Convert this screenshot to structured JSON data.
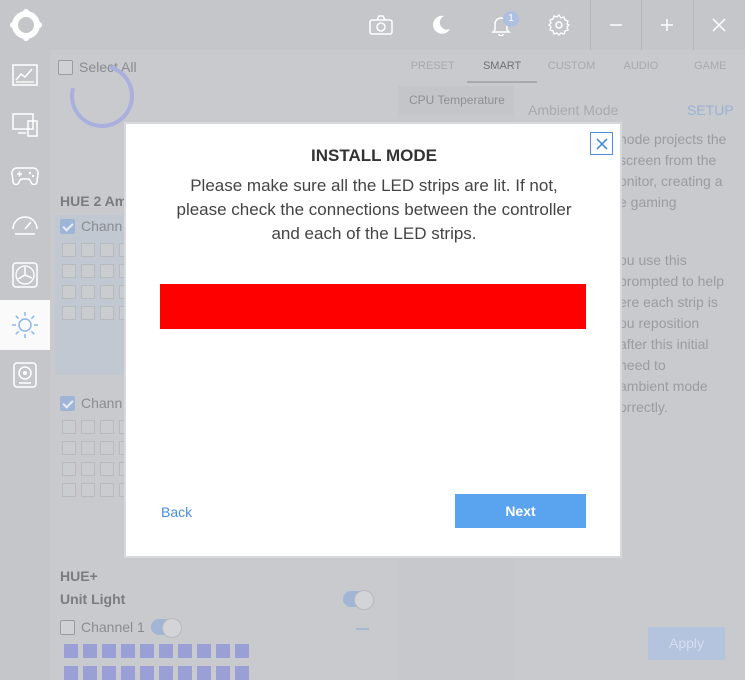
{
  "titlebar": {
    "notification_count": "1",
    "icons": [
      "camera-icon",
      "moon-icon",
      "bell-icon",
      "gear-icon",
      "minimize-icon",
      "maximize-icon",
      "close-icon"
    ]
  },
  "sidebar": {
    "items": [
      {
        "name": "dashboard",
        "icon": "monitor-chart-icon"
      },
      {
        "name": "pc-components",
        "icon": "desktop-icon"
      },
      {
        "name": "games",
        "icon": "gamepad-icon"
      },
      {
        "name": "performance",
        "icon": "gauge-icon"
      },
      {
        "name": "cooling",
        "icon": "fan-icon"
      },
      {
        "name": "lighting",
        "icon": "sun-icon",
        "active": true
      },
      {
        "name": "camera",
        "icon": "webcam-icon"
      }
    ]
  },
  "devices": {
    "select_all_label": "Select All",
    "hue2_title": "HUE 2 Am",
    "channel_label_1": "Chann",
    "channel_label_2": "Chann",
    "hueplus_title": "HUE+",
    "unit_light_label": "Unit Light",
    "channel1_label": "Channel 1"
  },
  "lighting_panel": {
    "tabs": [
      "PRESET",
      "SMART",
      "CUSTOM",
      "AUDIO",
      "GAME"
    ],
    "active_tab": "SMART",
    "cpu_item": "CPU Temperature",
    "mode_title": "Ambient Mode",
    "setup_label": "SETUP",
    "desc_lines_1": [
      "node projects the",
      "screen from the",
      "onitor, creating a",
      "e gaming"
    ],
    "desc_lines_2": [
      "ou use this",
      "prompted to help",
      "ere each strip is",
      "ou reposition",
      "after this initial",
      "need to",
      "ambient mode",
      "orrectly."
    ],
    "apply_label": "Apply"
  },
  "modal": {
    "title": "INSTALL MODE",
    "message": "Please make sure all the LED strips are lit. If not, please check the connections between the controller and each of the LED strips.",
    "led_color": "#ff0000",
    "back_label": "Back",
    "next_label": "Next"
  },
  "colors": {
    "accent": "#5aa3ee",
    "link": "#4a90d9",
    "led_strip": "#ff0000"
  }
}
